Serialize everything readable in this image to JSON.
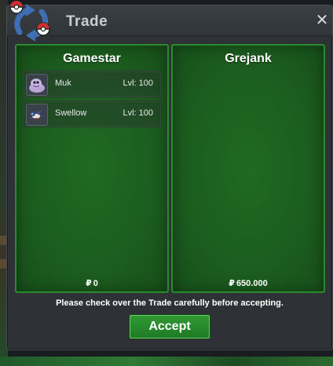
{
  "window": {
    "title": "Trade",
    "close_icon": "close-icon"
  },
  "colors": {
    "panel_green": "#1c5e1f",
    "panel_border": "#2a8a2e",
    "accept_green": "#2a8f2f",
    "title_text": "#c9ced3"
  },
  "left_panel": {
    "player": "Gamestar",
    "items": [
      {
        "name": "Muk",
        "level": "Lvl: 100",
        "icon": "muk-icon"
      },
      {
        "name": "Swellow",
        "level": "Lvl: 100",
        "icon": "swellow-icon"
      }
    ],
    "currency_symbol": "₽",
    "money": "0"
  },
  "right_panel": {
    "player": "Grejank",
    "items": [],
    "currency_symbol": "₽",
    "money": "650.000"
  },
  "footer": {
    "notice": "Please check over the Trade carefully before accepting.",
    "accept_label": "Accept"
  }
}
